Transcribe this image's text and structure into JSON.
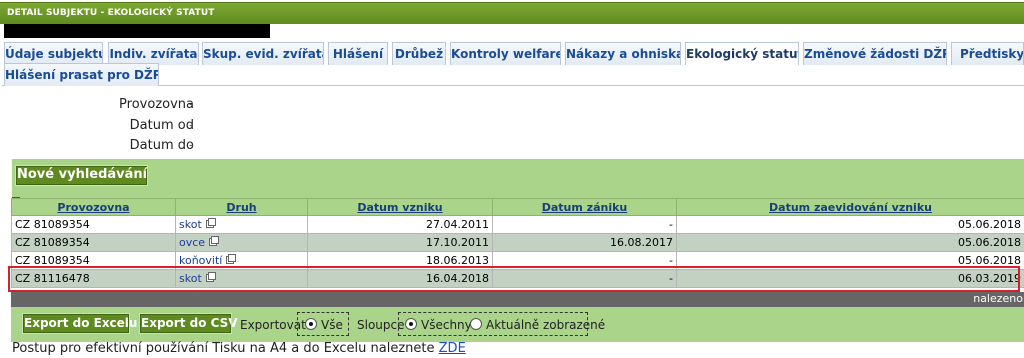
{
  "window": {
    "title": "DETAIL SUBJEKTU - EKOLOGICKÝ STATUT"
  },
  "tabs": [
    {
      "label": "Údaje subjektu"
    },
    {
      "label": "Indiv. zvířata"
    },
    {
      "label": "Skup. evid. zvířata"
    },
    {
      "label": "Hlášení"
    },
    {
      "label": "Drůbež"
    },
    {
      "label": "Kontroly welfare"
    },
    {
      "label": "Nákazy a ohniska"
    },
    {
      "label": "Ekologický statut"
    },
    {
      "label": "Změnové žádosti DŽPZ"
    },
    {
      "label": "Předtisky d"
    },
    {
      "label": "Hlášení prasat pro DŽPZ"
    }
  ],
  "filters": {
    "provozovna": "Provozovna",
    "datum_od": "Datum od",
    "datum_do": "Datum do",
    "dash": "-"
  },
  "new_search_label": "Nové vyhledávání",
  "grid": {
    "expand": "+",
    "columns": [
      "Provozovna",
      "Druh",
      "Datum vzniku",
      "Datum zániku",
      "Datum zaevidování vzniku"
    ],
    "rows": [
      {
        "provozovna": "CZ 81089354",
        "druh": "skot",
        "vznik": "27.04.2011",
        "zanik": "-",
        "zaevid": "05.06.2018"
      },
      {
        "provozovna": "CZ 81089354",
        "druh": "ovce",
        "vznik": "17.10.2011",
        "zanik": "16.08.2017",
        "zaevid": "05.06.2018"
      },
      {
        "provozovna": "CZ 81089354",
        "druh": "koňovití",
        "vznik": "18.06.2013",
        "zanik": "-",
        "zaevid": "05.06.2018"
      },
      {
        "provozovna": "CZ 81116478",
        "druh": "skot",
        "vznik": "16.04.2018",
        "zanik": "-",
        "zaevid": "06.03.2019"
      }
    ],
    "found_label": "nalezeno"
  },
  "export": {
    "excel_label": "Export do Excelu",
    "csv_label": "Export do CSV",
    "exportovat_label": "Exportovat",
    "vse_label": "Vše",
    "sloupce_label": "Sloupce",
    "vsechny_label": "Všechny",
    "aktualne_label": "Aktuálně zobrazené"
  },
  "help": {
    "text": "Postup pro efektivní používání Tisku na A4 a do Excelu naleznete",
    "link": "ZDE"
  },
  "colors": {
    "title_green": "#5f8a1f",
    "band_green": "#a9d48a",
    "row_alt": "#c3d1c3",
    "tab_text": "#1a4c93",
    "highlight": "#d6202b"
  }
}
